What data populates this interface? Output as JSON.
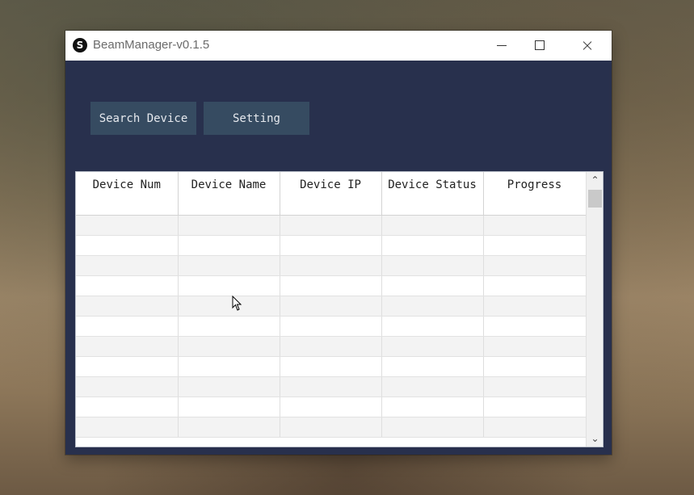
{
  "window": {
    "title": "BeamManager-v0.1.5",
    "logo_glyph": "S"
  },
  "toolbar": {
    "search_label": "Search Device",
    "setting_label": "Setting"
  },
  "table": {
    "headers": [
      "Device Num",
      "Device Name",
      "Device IP",
      "Device Status",
      "Progress"
    ],
    "rows": [],
    "visible_empty_rows": 11
  },
  "icons": {
    "scroll_up": "chevron-up-icon",
    "scroll_down": "chevron-down-icon",
    "minimize": "minimize-icon",
    "maximize": "maximize-icon",
    "close": "close-icon"
  },
  "colors": {
    "window_bg": "#28304d",
    "button_bg": "#364b61"
  }
}
